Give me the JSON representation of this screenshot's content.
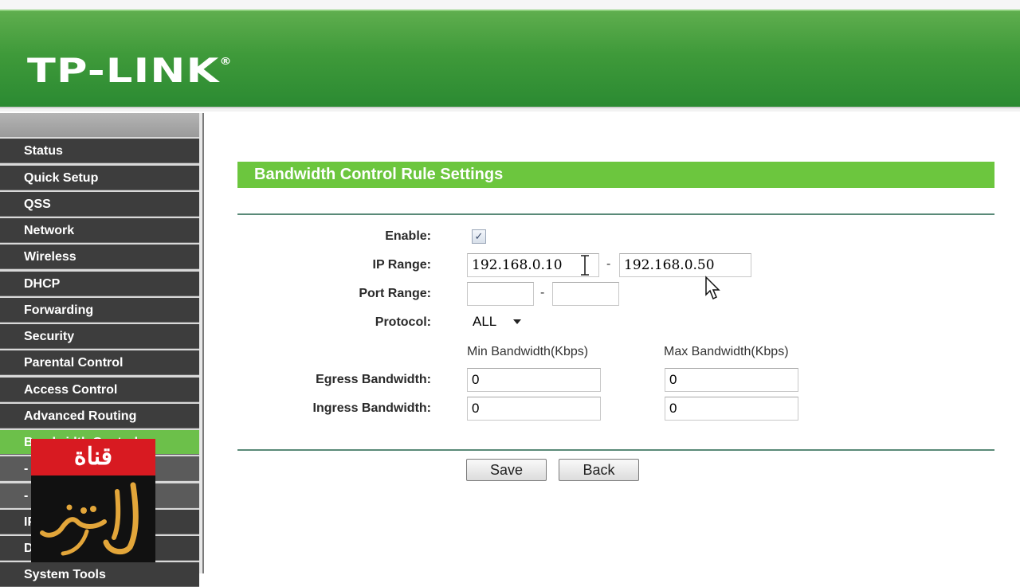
{
  "brand": {
    "logo_text": "TP-LINK",
    "logo_mark": "®"
  },
  "sidebar": {
    "items": [
      {
        "label": "Status"
      },
      {
        "label": "Quick Setup"
      },
      {
        "label": "QSS"
      },
      {
        "label": "Network"
      },
      {
        "label": "Wireless"
      },
      {
        "label": "DHCP"
      },
      {
        "label": "Forwarding"
      },
      {
        "label": "Security"
      },
      {
        "label": "Parental Control"
      },
      {
        "label": "Access Control"
      },
      {
        "label": "Advanced Routing"
      },
      {
        "label": "Bandwidth Control"
      },
      {
        "label": "- Control Settings"
      },
      {
        "label": "- Rules List"
      },
      {
        "label": "IP & MAC Binding"
      },
      {
        "label": "Dynamic DNS"
      },
      {
        "label": "System Tools"
      }
    ]
  },
  "watermark": {
    "top_text": "قناة"
  },
  "form": {
    "title": "Bandwidth Control Rule Settings",
    "enable_label": "Enable:",
    "enable_checked": true,
    "ip_range_label": "IP Range:",
    "ip_start": "192.168.0.10",
    "ip_end": "192.168.0.50",
    "port_range_label": "Port Range:",
    "port_start": "",
    "port_end": "",
    "protocol_label": "Protocol:",
    "protocol_value": "ALL",
    "min_bw_header": "Min Bandwidth(Kbps)",
    "max_bw_header": "Max Bandwidth(Kbps)",
    "egress_label": "Egress Bandwidth:",
    "egress_min": "0",
    "egress_max": "0",
    "ingress_label": "Ingress Bandwidth:",
    "ingress_min": "0",
    "ingress_max": "0",
    "range_separator": "-",
    "save_label": "Save",
    "back_label": "Back"
  },
  "colors": {
    "header_green": "#3f9a3a",
    "title_bar_green": "#6cc63e",
    "menu_dark": "#3d3d3d",
    "menu_active": "#6cc04a"
  },
  "icons": [
    "checkbox-check-icon",
    "dropdown-caret-icon",
    "text-cursor-icon",
    "mouse-pointer-icon"
  ]
}
